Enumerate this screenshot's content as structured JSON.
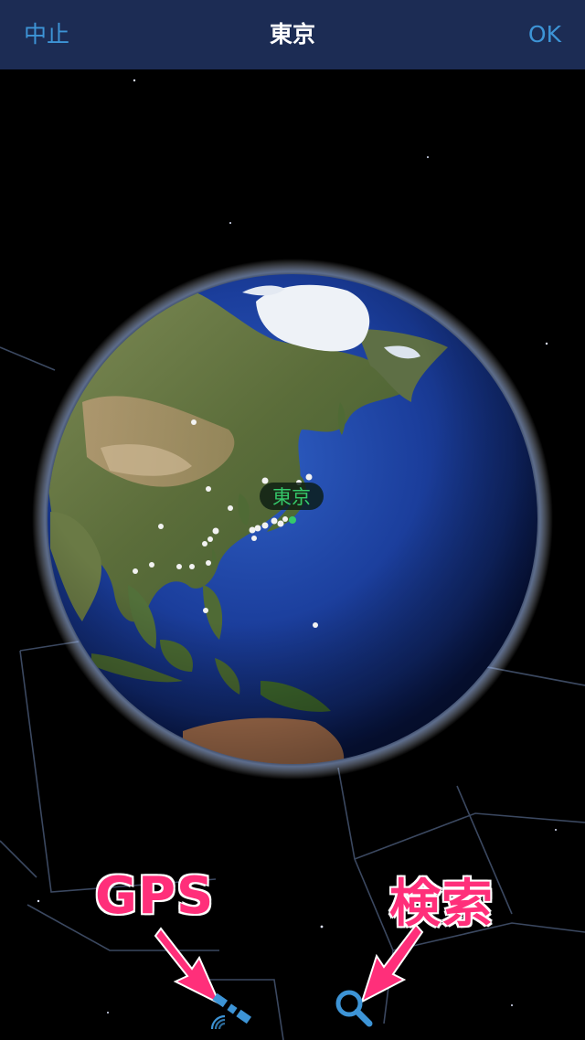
{
  "navbar": {
    "cancel_label": "中止",
    "title": "東京",
    "ok_label": "OK"
  },
  "globe": {
    "selected_city_label": "東京",
    "selected_city_color": "#35c96b"
  },
  "annotations": {
    "gps_label": "GPS",
    "search_label": "検索",
    "color": "#ff2f7a"
  },
  "toolbar": {
    "gps_icon": "satellite-gps-icon",
    "search_icon": "magnifier-search-icon",
    "icon_color": "#3d94d6"
  },
  "colors": {
    "navbar_bg": "#1c2c54",
    "accent": "#3d94d6",
    "ocean": "#1a3f9a"
  }
}
